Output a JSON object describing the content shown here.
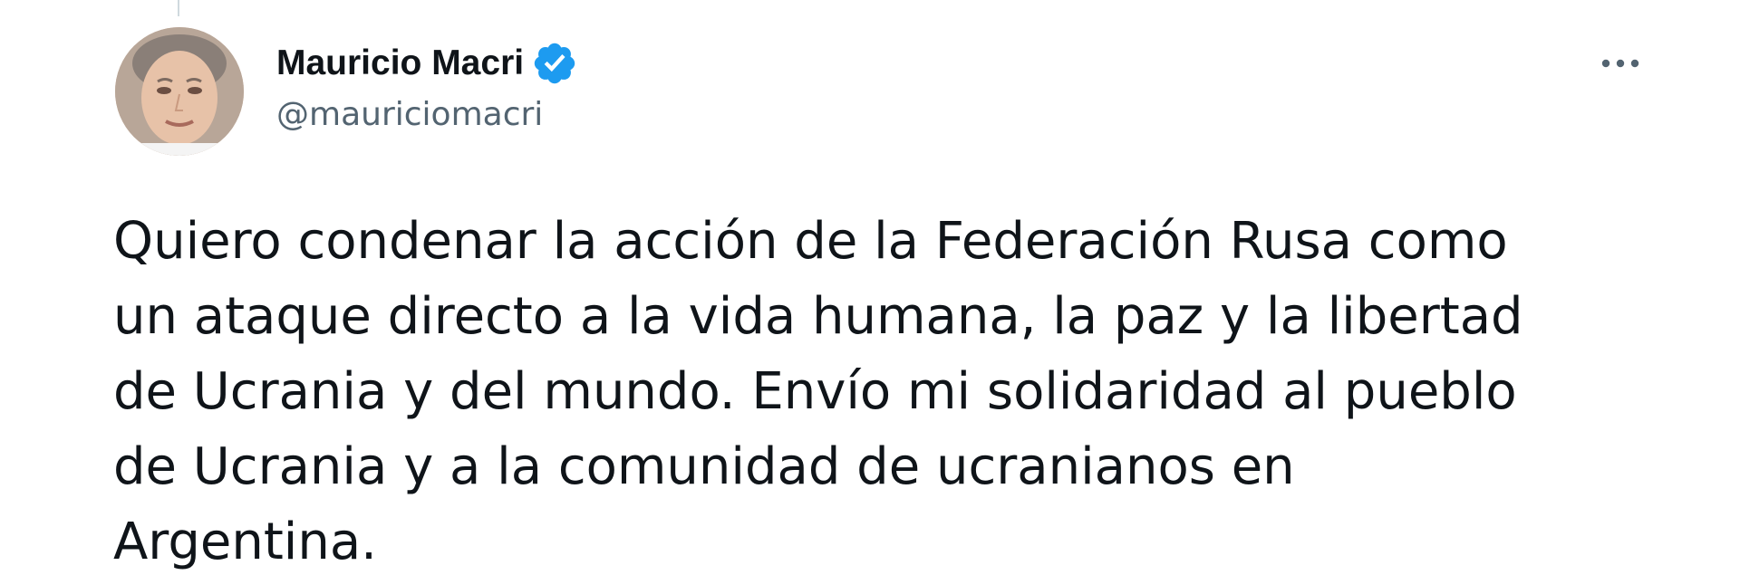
{
  "tweet": {
    "author": {
      "display_name": "Mauricio Macri",
      "handle": "@mauriciomacri",
      "verified": true,
      "avatar_icon": "profile-photo"
    },
    "more_icon": "more-horizontal-icon",
    "text": "Quiero condenar la acción de la Federación Rusa como\nun ataque directo a la vida humana, la paz y la libertad\nde Ucrania y del mundo. Envío mi solidaridad al pueblo\nde Ucrania y a la comunidad de ucranianos en\nArgentina."
  },
  "colors": {
    "text_primary": "#0f1419",
    "text_secondary": "#536471",
    "verified_blue": "#1d9bf0",
    "background": "#ffffff"
  }
}
